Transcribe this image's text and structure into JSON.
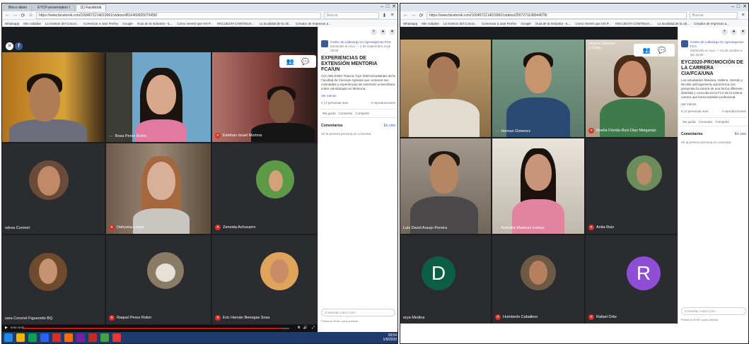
{
  "left": {
    "tabs": [
      "Bloco diario",
      "EYCP-presentation I",
      "(1) Facebook"
    ],
    "url": "https://www.facebook.com/1004571214010061/videos/4816460605076458/",
    "search_placeholder": "Buscar",
    "bookmarks": [
      "Whatsapp",
      "Mis rodadas",
      "La Gestion del Conoci...",
      "Comenzar a usar Firefox",
      "Google",
      "Guia de la Industria - IL...",
      "Como invertir que UN P...",
      "ENCUESTA CONTINUA ...",
      "La localidad de la citi...",
      "Creador de Impresos a..."
    ],
    "participants": [
      {
        "name": ""
      },
      {
        "name": "Rosa Perez Rolon"
      },
      {
        "name": "Esteban Israel Morinra"
      },
      {
        "name": "ndrea Coronel"
      },
      {
        "name": "Dahyana Lopez"
      },
      {
        "name": "Zeneida Achucarro"
      },
      {
        "name": "sara Coronel Figueredo BQ"
      },
      {
        "name": "Raquel Perez Rolon"
      },
      {
        "name": "Eric Hernán Benegas Sosa"
      }
    ],
    "fb": {
      "page_name": "Centro de Liderazgo en Agronegocios FCA",
      "page_meta": "transmitió en vivo — 1 de septiembre a las 18:55",
      "title": "EXPERIENCIAS DE EXTENSIÓN MENTORIA FCA/UN",
      "desc": "CIA-ABa EWIS 'Ruta la 'Cya' 2020 Estudiantes de la Facultad de Ciencias Agrarias que cursaron sus voluntades y experiencias de extensión universitaria sobre voluntariado en Mentoría.",
      "more": "Ver menos",
      "reactions": "2 | 2 personas mas",
      "shares": "2 reproducciones",
      "like": "Me gusta",
      "comment": "Comentar",
      "share": "Compartir",
      "comments_label": "Comentarios",
      "comments_link": "En vivo",
      "first_comment": "Sé la primera persona en comentar.",
      "input_placeholder": "Comentar como Com...",
      "hint": "Presiona 'Enter' para publicar."
    },
    "video": {
      "time": "0:00 / 0:02",
      "progress": 0.97
    },
    "clock": {
      "time": "18:54",
      "date": "1/9/2020"
    }
  },
  "right": {
    "url": "https://www.facebook.com/1004571214010061/videos/2557271198044078/",
    "search_placeholder": "Buscar",
    "bookmarks": [
      "Whatsapp",
      "Mis rodadas",
      "La Gestion del Conoci...",
      "Comenzar a usar Firefox",
      "Google",
      "Guia de la Industria - IL...",
      "Como invertir que UN P...",
      "ENCUESTA CONTINUA ...",
      "La localidad de la citi...",
      "Creador de Impresos a..."
    ],
    "participants": [
      {
        "name": ""
      },
      {
        "name": "Hernan Gimenez"
      },
      {
        "name": "Noelia Florida Ruiz Diaz Melgarejo"
      },
      {
        "name": "Luis David Araujo Pereira"
      },
      {
        "name": "Nathalia Martinez Insfran"
      },
      {
        "name": "Anita Ruiz"
      },
      {
        "name": "orya Medina"
      },
      {
        "name": "Humberto Caballero"
      },
      {
        "name": "Rafael Ortiz"
      }
    ],
    "letters": [
      "D",
      "R"
    ],
    "presenter": "Jessica Gimenez",
    "presenter_sub": "y 3 mas",
    "fb": {
      "page_name": "Centro de Liderazgo en Agronegocios FCA",
      "page_meta": "transmitió en vivo — 23 de octubre a las 18:50",
      "title": "EYC2020-PROMOCIÓN DE LA CARRERA CIA/FCA/UNA",
      "desc": "Los estudiantes Mariana, Vallerio, Hernán y Nicolás del Ingeniería Agronómica nos presentan la carrera de una forma diferente, divertida y conocida en la FCA de la misma carrera que forma también profesional.",
      "more": "Ver menos",
      "reactions": "6 | 6 personas mas",
      "shares": "4 reproducciones",
      "like": "Me gusta",
      "comment": "Comentar",
      "share": "Compartir",
      "comments_label": "Comentarios",
      "comments_link": "En vivo",
      "first_comment": "Sé la primera persona en comentar.",
      "input_placeholder": "Comentar como Com...",
      "hint": "Presiona 'Enter' para publicar."
    }
  },
  "colors": {
    "fb_blue": "#3b5998",
    "stage": "#1c1d20",
    "mic_off": "#d93025",
    "taskbar": "#1f3a6d",
    "avatar_green": "#0b5e44",
    "avatar_purple": "#8e4fd6"
  }
}
